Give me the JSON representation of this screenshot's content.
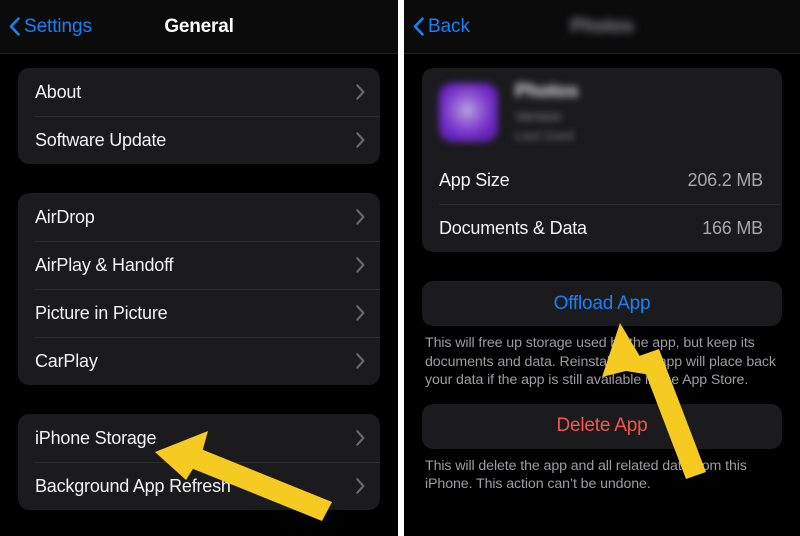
{
  "meta": {
    "accent_blue": "#1482fa",
    "destructive_red": "#f7544c",
    "arrow_yellow": "#f5cb21",
    "card_bg": "#1b1b1d",
    "page_bg": "#000000"
  },
  "left_panel": {
    "navbar": {
      "back_label": "Settings",
      "title": "General"
    },
    "groups": [
      {
        "rows": [
          {
            "label": "About",
            "value": "",
            "accessory": "chevron-right-icon"
          },
          {
            "label": "Software Update",
            "value": "",
            "accessory": "chevron-right-icon"
          }
        ]
      },
      {
        "rows": [
          {
            "label": "AirDrop",
            "value": "",
            "accessory": "chevron-right-icon"
          },
          {
            "label": "AirPlay & Handoff",
            "value": "",
            "accessory": "chevron-right-icon"
          },
          {
            "label": "Picture in Picture",
            "value": "",
            "accessory": "chevron-right-icon"
          },
          {
            "label": "CarPlay",
            "value": "",
            "accessory": "chevron-right-icon"
          }
        ]
      },
      {
        "rows": [
          {
            "label": "iPhone Storage",
            "value": "",
            "accessory": "chevron-right-icon"
          },
          {
            "label": "Background App Refresh",
            "value": "",
            "accessory": "chevron-right-icon"
          }
        ]
      }
    ]
  },
  "right_panel": {
    "navbar": {
      "back_label": "Back",
      "title": "Photos",
      "title_redacted": true
    },
    "app_header": {
      "name": "Photos",
      "line2": "Version",
      "line3": "Last Used",
      "redacted": true
    },
    "info_rows": [
      {
        "label": "App Size",
        "value": "206.2 MB"
      },
      {
        "label": "Documents & Data",
        "value": "166 MB"
      }
    ],
    "offload": {
      "button_label": "Offload App",
      "footnote": "This will free up storage used by the app, but keep its documents and data. Reinstalling the app will place back your data if the app is still available in the App Store."
    },
    "delete": {
      "button_label": "Delete App",
      "footnote": "This will delete the app and all related data from this iPhone. This action can’t be undone."
    }
  },
  "annotations": [
    {
      "name": "arrow-to-iphone-storage",
      "color": "#f5cb21"
    },
    {
      "name": "arrow-to-offload-app",
      "color": "#f5cb21"
    }
  ]
}
